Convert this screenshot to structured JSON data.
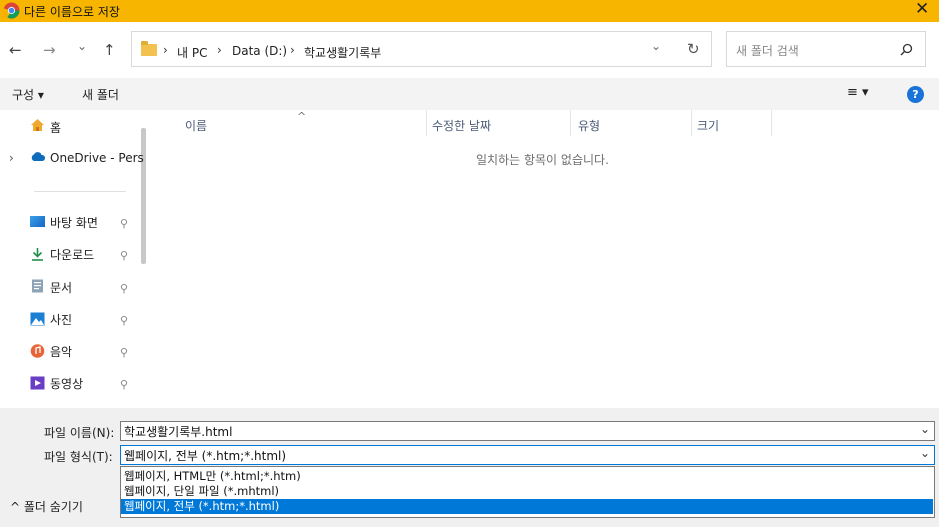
{
  "window": {
    "title": "다른 이름으로 저장",
    "close_glyph": "✕"
  },
  "nav_buttons": {
    "back": "←",
    "forward": "→",
    "recent": "⌄",
    "up": "↑"
  },
  "address": {
    "crumbs": [
      "내 PC",
      "Data (D:)",
      "학교생활기록부"
    ],
    "separator": "›",
    "dropdown_glyph": "⌄",
    "refresh_glyph": "↻"
  },
  "search": {
    "placeholder": "새 폴더 검색",
    "icon": "search-icon"
  },
  "toolbar": {
    "organize": "구성 ▾",
    "new_folder": "새 폴더",
    "view_glyph": "≡ ▾",
    "help": "?"
  },
  "sidebar": {
    "items": [
      {
        "label": "홈",
        "icon": "home-icon",
        "pinned": false
      },
      {
        "label": "OneDrive - Pers",
        "icon": "cloud-icon",
        "pinned": false
      },
      {
        "label": "바탕 화면",
        "icon": "desktop-icon",
        "pinned": true
      },
      {
        "label": "다운로드",
        "icon": "download-icon",
        "pinned": true
      },
      {
        "label": "문서",
        "icon": "document-icon",
        "pinned": true
      },
      {
        "label": "사진",
        "icon": "picture-icon",
        "pinned": true
      },
      {
        "label": "음악",
        "icon": "music-icon",
        "pinned": true
      },
      {
        "label": "동영상",
        "icon": "video-icon",
        "pinned": true
      }
    ],
    "expander": "›",
    "pin_glyph": "📌"
  },
  "columns": [
    "이름",
    "수정한 날짜",
    "유형",
    "크기"
  ],
  "sort_glyph": "^",
  "empty_message": "일치하는 항목이 없습니다.",
  "form": {
    "filename_label": "파일 이름(N):",
    "filename_value": "학교생활기록부.html",
    "filetype_label": "파일 형식(T):",
    "filetype_value": "웹페이지, 전부 (*.htm;*.html)",
    "filetype_options": [
      "웹페이지, HTML만 (*.html;*.htm)",
      "웹페이지, 단일 파일 (*.mhtml)",
      "웹페이지, 전부 (*.htm;*.html)"
    ],
    "selected_option_index": 2
  },
  "hide_folders": "^ 폴더 숨기기"
}
